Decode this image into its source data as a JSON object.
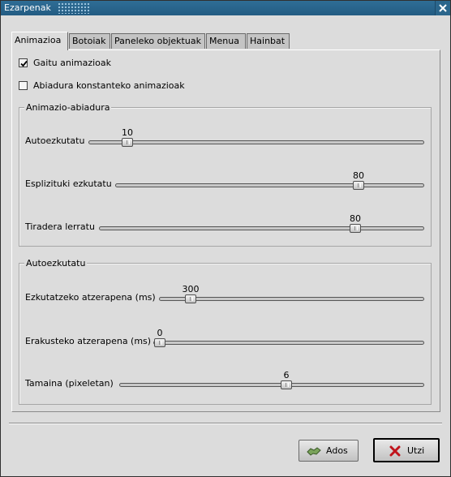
{
  "window": {
    "title": "Ezarpenak"
  },
  "tabs": [
    {
      "label": "Animazioa"
    },
    {
      "label": "Botoiak"
    },
    {
      "label": "Paneleko objektuak"
    },
    {
      "label": "Menua"
    },
    {
      "label": "Hainbat"
    }
  ],
  "active_tab": "Animazioa",
  "checks": {
    "enable": {
      "label": "Gaitu animazioak",
      "checked": true
    },
    "constant": {
      "label": "Abiadura konstanteko animazioak",
      "checked": false
    }
  },
  "speed_group": {
    "title": "Animazio-abiadura",
    "autohide": {
      "label": "Autoezkutatu",
      "value": "10",
      "fraction": 0.1
    },
    "explicit": {
      "label": "Esplizituki ezkutatu",
      "value": "80",
      "fraction": 0.8
    },
    "drawer": {
      "label": "Tiradera lerratu",
      "value": "80",
      "fraction": 0.8
    }
  },
  "autohide_group": {
    "title": "Autoezkutatu",
    "hide_delay": {
      "label": "Ezkutatzeko atzerapena (ms)",
      "value": "300",
      "fraction": 0.1
    },
    "show_delay": {
      "label": "Erakusteko atzerapena (ms)",
      "value": "0",
      "fraction": 0.0
    },
    "size": {
      "label": "Tamaina (pixeletan)",
      "value": "6",
      "fraction": 0.55
    }
  },
  "buttons": {
    "help": {
      "label": "Ados",
      "icon": "handshake-icon"
    },
    "close": {
      "label": "Utzi",
      "icon": "cross-icon"
    }
  }
}
